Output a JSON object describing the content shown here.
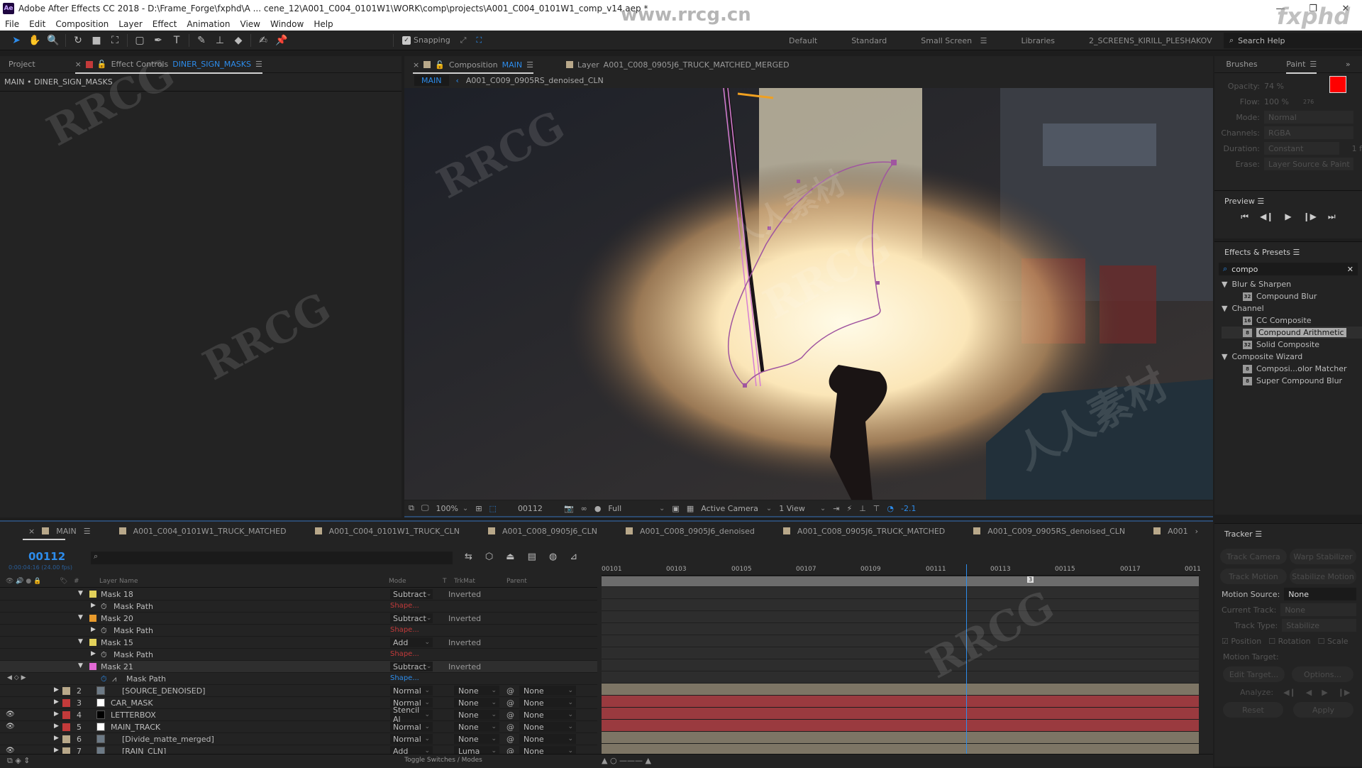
{
  "title_bar": {
    "app_icon": "Ae",
    "title": "Adobe After Effects CC 2018 - D:\\Frame_Forge\\fxphd\\A ... cene_12\\A001_C004_0101W1\\WORK\\comp\\projects\\A001_C004_0101W1_comp_v14.aep *",
    "minimize_icon": "—",
    "restore_icon": "❐",
    "close_icon": "✕"
  },
  "menu": [
    "File",
    "Edit",
    "Composition",
    "Layer",
    "Effect",
    "Animation",
    "View",
    "Window",
    "Help"
  ],
  "toolbar": {
    "tools": [
      {
        "name": "selection-tool",
        "glyph": "➤"
      },
      {
        "name": "hand-tool",
        "glyph": "✋"
      },
      {
        "name": "zoom-tool",
        "glyph": "🔍"
      },
      {
        "name": "rotate-tool",
        "glyph": "↻"
      },
      {
        "name": "camera-tool",
        "glyph": "■"
      },
      {
        "name": "pan-behind-tool",
        "glyph": "⛶"
      },
      {
        "name": "rectangle-tool",
        "glyph": "▢"
      },
      {
        "name": "pen-tool",
        "glyph": "✒"
      },
      {
        "name": "type-tool",
        "glyph": "T"
      },
      {
        "name": "brush-tool",
        "glyph": "✎"
      },
      {
        "name": "clone-stamp-tool",
        "glyph": "⊥"
      },
      {
        "name": "eraser-tool",
        "glyph": "◆"
      },
      {
        "name": "roto-brush-tool",
        "glyph": "✍"
      },
      {
        "name": "puppet-pin-tool",
        "glyph": "📌"
      }
    ],
    "snapping_label": "Snapping",
    "snapping_checked": true,
    "workspaces": [
      "Default",
      "Standard",
      "Small Screen",
      "Libraries",
      "2_SCREENS_KIRILL_PLESHAKOV"
    ],
    "active_workspace": "Small Screen",
    "overflow_icon": "»",
    "search_help_placeholder": "Search Help"
  },
  "left_panel": {
    "tabs": [
      {
        "label": "Project"
      },
      {
        "label": "Effect Controls",
        "target": "DINER_SIGN_MASKS"
      }
    ],
    "close_icon": "×",
    "breadcrumb": "MAIN • DINER_SIGN_MASKS"
  },
  "composition_panel": {
    "tab_label": "Composition",
    "tab_comp": "MAIN",
    "layer_tab_label": "Layer",
    "layer_tab_target": "A001_C008_0905J6_TRUCK_MATCHED_MERGED",
    "nav_crumbs": [
      "MAIN",
      "A001_C009_0905RS_denoised_CLN"
    ],
    "footer": {
      "magnification": "100%",
      "current_frame": "00112",
      "resolution": "Full",
      "camera": "Active Camera",
      "views": "1 View",
      "exposure": "-2.1"
    }
  },
  "paint_panel": {
    "tabs": [
      "Brushes",
      "Paint"
    ],
    "active_tab": "Paint",
    "opacity_label": "Opacity:",
    "opacity_value": "74 %",
    "flow_label": "Flow:",
    "flow_value": "100 %",
    "brush_size": "276",
    "foreground_color": "#ff0000",
    "background_color": "#ffffff",
    "mode_label": "Mode:",
    "mode_value": "Normal",
    "channels_label": "Channels:",
    "channels_value": "RGBA",
    "duration_label": "Duration:",
    "duration_value": "Constant",
    "duration_frames": "1 f",
    "erase_label": "Erase:",
    "erase_value": "Layer Source & Paint"
  },
  "preview_panel": {
    "title": "Preview",
    "controls": [
      "first-frame",
      "previous-frame",
      "play",
      "next-frame",
      "last-frame"
    ],
    "glyphs": [
      "⏮",
      "◀❙",
      "▶",
      "❙▶",
      "⏭"
    ]
  },
  "effects_presets": {
    "title": "Effects & Presets",
    "search_value": "compo",
    "groups": [
      {
        "name": "Blur & Sharpen",
        "items": [
          {
            "label": "Compound Blur",
            "bits": "32"
          }
        ]
      },
      {
        "name": "Channel",
        "items": [
          {
            "label": "CC Composite",
            "bits": "16"
          },
          {
            "label": "Compound Arithmetic",
            "bits": "8",
            "selected": true
          },
          {
            "label": "Solid Composite",
            "bits": "32"
          }
        ]
      },
      {
        "name": "Composite Wizard",
        "items": [
          {
            "label": "Composi...olor Matcher",
            "bits": "8"
          },
          {
            "label": "Super Compound Blur",
            "bits": "8"
          }
        ]
      }
    ]
  },
  "tracker_panel": {
    "title": "Tracker",
    "buttons": [
      "Track Camera",
      "Warp Stabilizer",
      "Track Motion",
      "Stabilize Motion"
    ],
    "motion_source_label": "Motion Source:",
    "motion_source_value": "None",
    "current_track_label": "Current Track:",
    "current_track_value": "None",
    "track_type_label": "Track Type:",
    "track_type_value": "Stabilize",
    "checks": [
      {
        "label": "Position",
        "checked": true
      },
      {
        "label": "Rotation",
        "checked": false
      },
      {
        "label": "Scale",
        "checked": false
      }
    ],
    "motion_target_label": "Motion Target:",
    "edit_target": "Edit Target...",
    "options": "Options...",
    "analyze_label": "Analyze:",
    "reset": "Reset",
    "apply": "Apply"
  },
  "timeline": {
    "tabs": [
      "MAIN",
      "A001_C004_0101W1_TRUCK_MATCHED",
      "A001_C004_0101W1_TRUCK_CLN",
      "A001_C008_0905J6_CLN",
      "A001_C008_0905J6_denoised",
      "A001_C008_0905J6_TRUCK_MATCHED",
      "A001_C009_0905RS_denoised_CLN",
      "A001"
    ],
    "timecode": "00112",
    "timecode_sub": "0:00:04:16 (24.00 fps)",
    "columns": {
      "layer_name": "Layer Name",
      "mode": "Mode",
      "t": "T",
      "trkmat": "TrkMat",
      "parent": "Parent",
      "num": "#"
    },
    "ruler": [
      "00101",
      "00103",
      "00105",
      "00107",
      "00109",
      "00111",
      "00113",
      "00115",
      "00117",
      "0011"
    ],
    "current_frame_fraction": 0.61,
    "marker_label": "3",
    "masks": [
      {
        "name": "Mask 18",
        "color": "#e2d15a",
        "mode": "Subtract",
        "inverted": "Inverted",
        "path": "Mask Path",
        "shape": "Shape..."
      },
      {
        "name": "Mask 20",
        "color": "#e89a2c",
        "mode": "Subtract",
        "inverted": "Inverted",
        "path": "Mask Path",
        "shape": "Shape..."
      },
      {
        "name": "Mask 15",
        "color": "#e2d15a",
        "mode": "Add",
        "inverted": "Inverted",
        "path": "Mask Path",
        "shape": "Shape..."
      },
      {
        "name": "Mask 21",
        "color": "#e36ad6",
        "mode": "Subtract",
        "inverted": "Inverted",
        "path": "Mask Path",
        "shape": "Shape...",
        "selected": true
      }
    ],
    "layers": [
      {
        "num": "2",
        "name": "[SOURCE_DENOISED]",
        "label_color": "#b8a88a",
        "thumb": "precomp",
        "mode": "Normal",
        "trkmat": "None",
        "parent": "None",
        "visible": false,
        "bar_color": "#7d7565"
      },
      {
        "num": "3",
        "name": "CAR_MASK",
        "label_color": "#c33a3a",
        "thumb": "white",
        "mode": "Normal",
        "trkmat": "None",
        "parent": "None",
        "visible": false,
        "bar_color": "#9a3a3f"
      },
      {
        "num": "4",
        "name": "LETTERBOX",
        "label_color": "#c33a3a",
        "thumb": "black",
        "mode": "Stencil Al",
        "trkmat": "None",
        "parent": "None",
        "visible": true,
        "bar_color": "#9a3a3f"
      },
      {
        "num": "5",
        "name": "MAIN_TRACK",
        "label_color": "#c33a3a",
        "thumb": "white",
        "mode": "Normal",
        "trkmat": "None",
        "parent": "None",
        "visible": true,
        "bar_color": "#9a3a3f"
      },
      {
        "num": "6",
        "name": "[Divide_matte_merged]",
        "label_color": "#b8a88a",
        "thumb": "precomp",
        "mode": "Normal",
        "trkmat": "None",
        "parent": "None",
        "visible": false,
        "bar_color": "#7d7565"
      },
      {
        "num": "7",
        "name": "[RAIN_CLN]",
        "label_color": "#b8a88a",
        "thumb": "precomp",
        "mode": "Add",
        "trkmat": "Luma",
        "parent": "None",
        "visible": true,
        "bar_color": "#7d7565"
      }
    ],
    "toggle_label": "Toggle Switches / Modes"
  },
  "watermarks": [
    "RRCG",
    "人人素材",
    "www.rrcg.cn",
    "fxphd"
  ]
}
